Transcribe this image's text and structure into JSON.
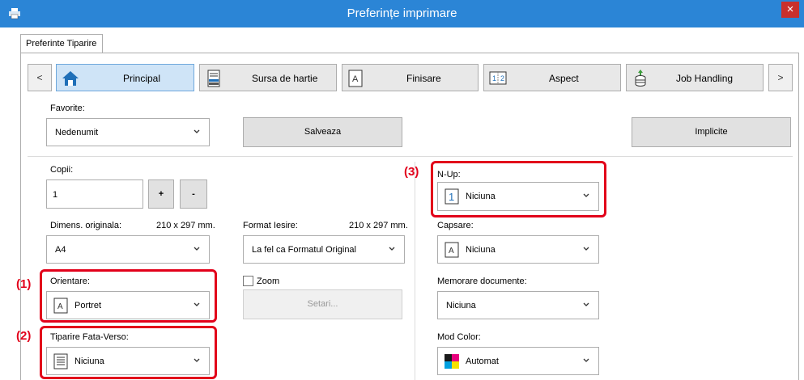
{
  "window": {
    "title": "Preferințe imprimare",
    "close_glyph": "×"
  },
  "tab": {
    "label": "Preferinte Tiparire"
  },
  "nav": {
    "prev": "<",
    "next": ">",
    "items": [
      {
        "label": "Principal",
        "icon": "home-icon",
        "active": true
      },
      {
        "label": "Sursa de hartie",
        "icon": "paper-tray-icon",
        "active": false
      },
      {
        "label": "Finisare",
        "icon": "finishing-page-icon",
        "active": false
      },
      {
        "label": "Aspect",
        "icon": "layout-pages-icon",
        "active": false
      },
      {
        "label": "Job Handling",
        "icon": "job-stack-icon",
        "active": false
      }
    ]
  },
  "favorites": {
    "label": "Favorite:",
    "value": "Nedenumit",
    "save": "Salveaza",
    "defaults": "Implicite"
  },
  "copies": {
    "label": "Copii:",
    "value": "1",
    "plus": "+",
    "minus": "-"
  },
  "original_size": {
    "label": "Dimens. originala:",
    "size": "210 x 297 mm.",
    "value": "A4"
  },
  "output_format": {
    "label": "Format Iesire:",
    "size": "210 x 297 mm.",
    "value": "La fel ca Formatul Original"
  },
  "orientation": {
    "label": "Orientare:",
    "value": "Portret",
    "icon_letter": "A"
  },
  "zoom": {
    "label": "Zoom",
    "checked": false,
    "settings": "Setari..."
  },
  "duplex": {
    "label": "Tiparire Fata-Verso:",
    "value": "Niciuna"
  },
  "nup": {
    "label": "N-Up:",
    "value": "Niciuna",
    "icon_digit": "1"
  },
  "staple": {
    "label": "Capsare:",
    "value": "Niciuna",
    "icon_letter": "A"
  },
  "doc_filing": {
    "label": "Memorare documente:",
    "value": "Niciuna"
  },
  "color_mode": {
    "label": "Mod Color:",
    "value": "Automat"
  },
  "callouts": {
    "c1": "(1)",
    "c2": "(2)",
    "c3": "(3)"
  },
  "colors": {
    "titlebar": "#2b85d6",
    "highlight": "#e2001a",
    "active_tab": "#cfe4f7"
  }
}
